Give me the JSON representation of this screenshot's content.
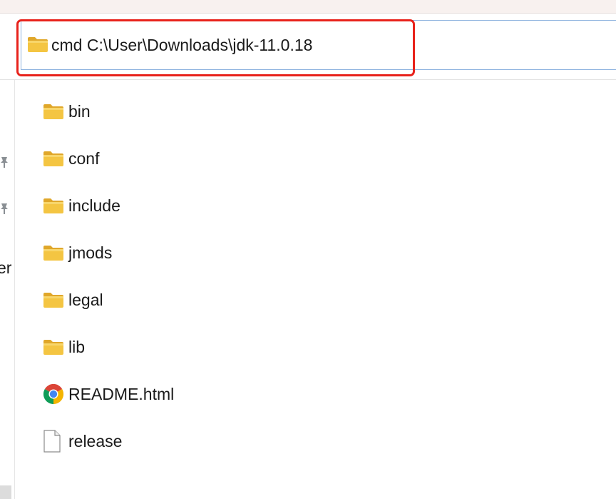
{
  "address_bar": {
    "value": "cmd C:\\User\\Downloads\\jdk-11.0.18",
    "folder_icon": "folder-icon"
  },
  "nav_pane": {
    "partial_text": "er"
  },
  "files": [
    {
      "name": "bin",
      "icon": "folder-icon"
    },
    {
      "name": "conf",
      "icon": "folder-icon"
    },
    {
      "name": "include",
      "icon": "folder-icon"
    },
    {
      "name": "jmods",
      "icon": "folder-icon"
    },
    {
      "name": "legal",
      "icon": "folder-icon"
    },
    {
      "name": "lib",
      "icon": "folder-icon"
    },
    {
      "name": "README.html",
      "icon": "chrome-icon"
    },
    {
      "name": "release",
      "icon": "file-icon"
    }
  ],
  "colors": {
    "highlight": "#e8221b",
    "folder": "#f4c542",
    "address_border": "#8fb3df"
  }
}
